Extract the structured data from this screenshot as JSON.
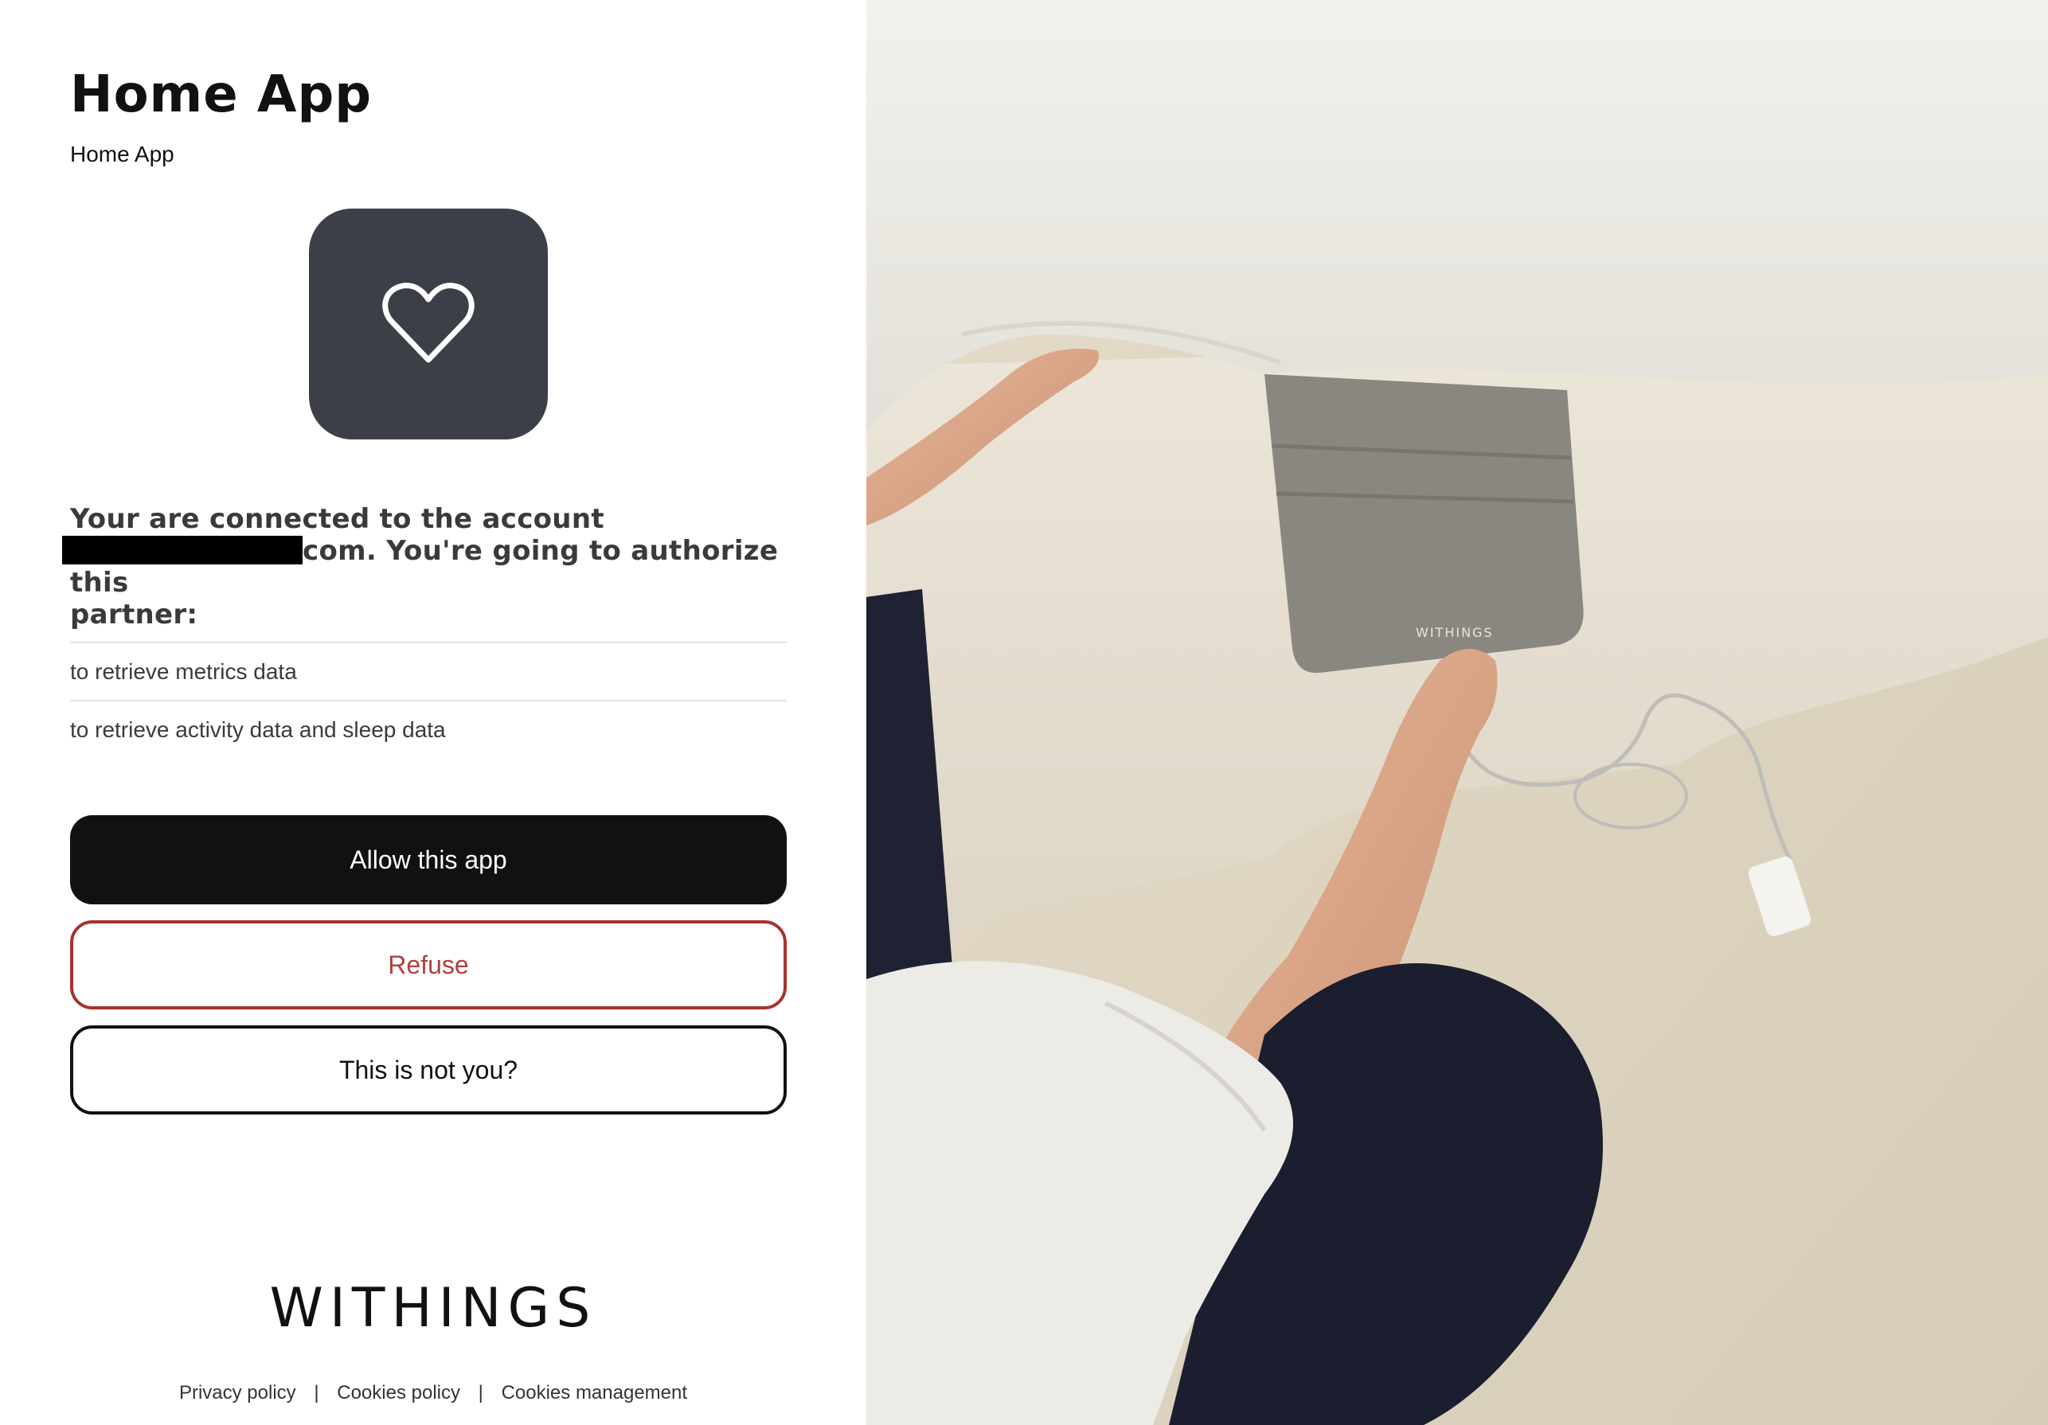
{
  "app": {
    "title": "Home App",
    "subtitle": "Home App",
    "icon": "heart-icon"
  },
  "consent": {
    "line1": "Your are connected to the account",
    "line2": "com. You're going to authorize this",
    "line3": "partner:"
  },
  "permissions": [
    "to retrieve metrics data",
    "to retrieve activity data and sleep data"
  ],
  "buttons": {
    "allow": "Allow this app",
    "refuse": "Refuse",
    "not_you": "This is not you?"
  },
  "brand": {
    "logo": "WITHINGS"
  },
  "photo": {
    "pad_label": "WITHINGS"
  },
  "footer": {
    "privacy": "Privacy policy",
    "cookies": "Cookies policy",
    "cookies_mgmt": "Cookies management",
    "separator": "|"
  },
  "colors": {
    "primary": "#111111",
    "refuse": "#a8322d",
    "icon_bg": "#3c3f48"
  }
}
